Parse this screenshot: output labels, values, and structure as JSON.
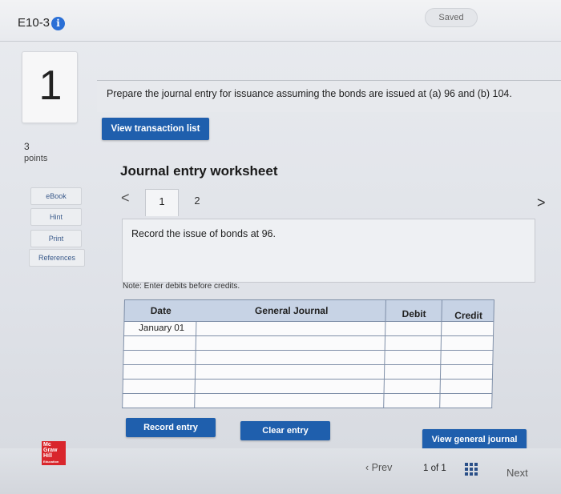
{
  "header": {
    "question_id": "E10-3",
    "saved_label": "Saved"
  },
  "question": {
    "number": "1",
    "points_value": "3",
    "points_label": "points",
    "prompt": "Prepare the journal entry for issuance assuming the bonds are issued at (a) 96 and (b) 104."
  },
  "sidebar": {
    "items": [
      "eBook",
      "Hint",
      "Print",
      "References"
    ]
  },
  "actions": {
    "view_transactions": "View transaction list"
  },
  "worksheet": {
    "title": "Journal entry worksheet",
    "tabs": [
      "1",
      "2"
    ],
    "instruction": "Record the issue of bonds at 96.",
    "note": "Note: Enter debits before credits.",
    "columns": [
      "Date",
      "General Journal",
      "Debit",
      "Credit"
    ],
    "rows": [
      {
        "date": "January 01"
      },
      {
        "date": ""
      },
      {
        "date": ""
      },
      {
        "date": ""
      },
      {
        "date": ""
      },
      {
        "date": ""
      }
    ],
    "record_label": "Record entry",
    "clear_label": "Clear entry",
    "view_journal_label": "View general journal"
  },
  "logo": {
    "text": "Mc Graw Hill Education"
  },
  "pagination": {
    "prev_label": "Prev",
    "current": "1",
    "of_label": "of",
    "total": "1",
    "next_label": "Next"
  },
  "colors": {
    "accent_blue": "#1f5fad",
    "header_blue": "#c7d3e5",
    "logo_red": "#d9262c"
  }
}
